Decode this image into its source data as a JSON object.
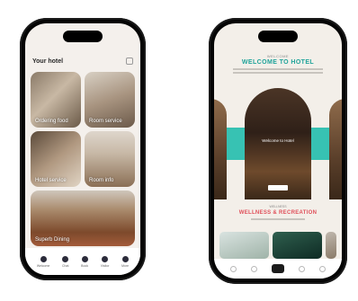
{
  "left_phone": {
    "header": {
      "title": "Your hotel"
    },
    "tiles": [
      {
        "label": "Ordering food"
      },
      {
        "label": "Room service"
      },
      {
        "label": "Hotel service"
      },
      {
        "label": "Room info"
      },
      {
        "label": "Superb Dining"
      }
    ],
    "tabbar": [
      {
        "label": "Welcome"
      },
      {
        "label": "Chat"
      },
      {
        "label": "Book"
      },
      {
        "label": "Visitor"
      },
      {
        "label": "More"
      }
    ]
  },
  "right_phone": {
    "welcome": {
      "kicker": "WELCOME",
      "heading": "WELCOME TO HOTEL"
    },
    "arch": {
      "title": "Welcome to Hotel"
    },
    "section2": {
      "kicker": "WELLNESS",
      "heading": "WELLNESS & RECREATION"
    }
  },
  "colors": {
    "teal": "#37c2b3",
    "teal_text": "#1fa39a",
    "coral_text": "#e0505a"
  }
}
